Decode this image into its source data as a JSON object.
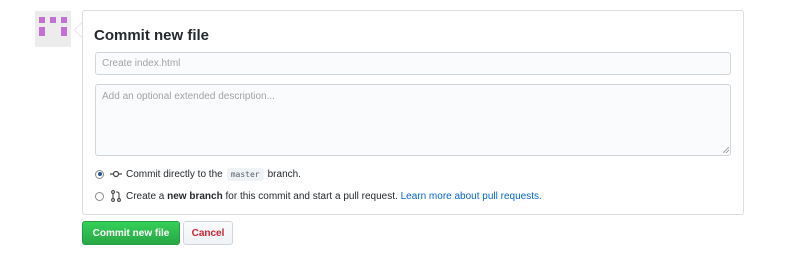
{
  "form": {
    "title": "Commit new file",
    "summary_placeholder": "Create index.html",
    "summary_value": "",
    "description_placeholder": "Add an optional extended description...",
    "description_value": ""
  },
  "options": {
    "direct": {
      "selected": true,
      "text_before": "Commit directly to the",
      "branch": "master",
      "text_after": "branch.",
      "icon": "git-commit-icon"
    },
    "new_branch": {
      "selected": false,
      "text_before": "Create a",
      "bold": "new branch",
      "text_after": "for this commit and start a pull request.",
      "link": "Learn more about pull requests.",
      "icon": "git-pull-request-icon"
    }
  },
  "buttons": {
    "commit": "Commit new file",
    "cancel": "Cancel"
  },
  "colors": {
    "commit_button": "#28a745",
    "cancel_text": "#cb2431",
    "link": "#0366d6",
    "avatar": "#c36fd6"
  }
}
